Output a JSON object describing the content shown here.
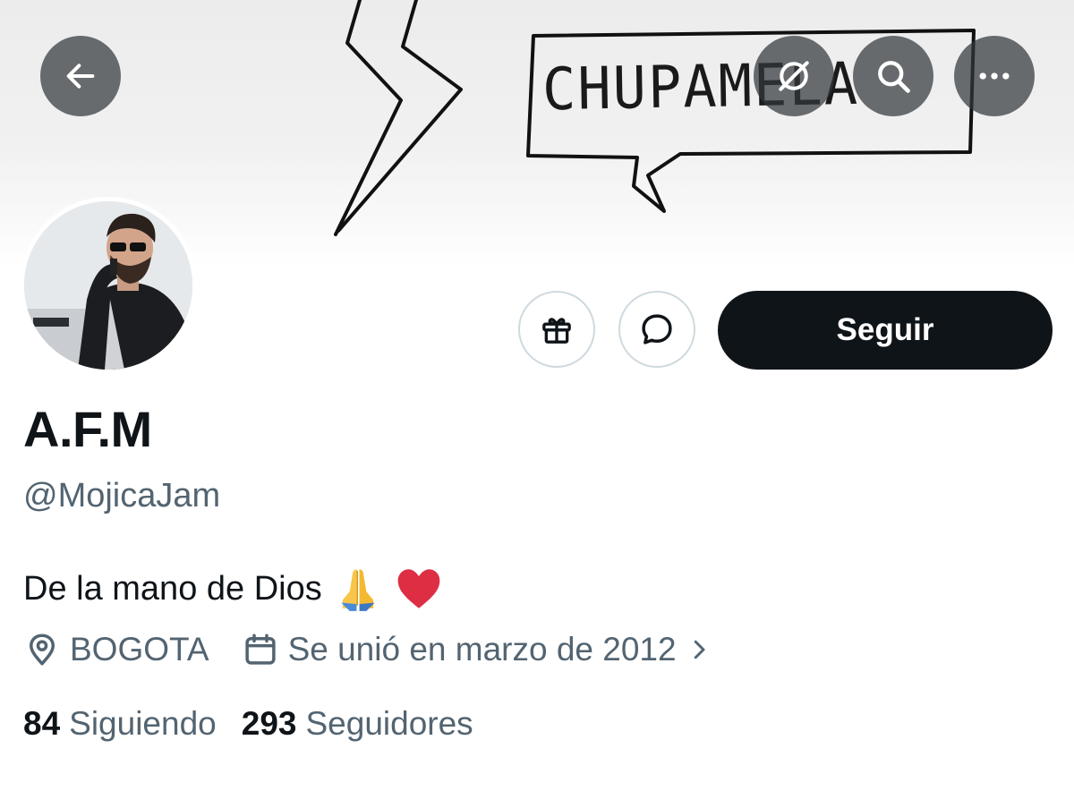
{
  "banner": {
    "drawing_text": "CHUPAMELA"
  },
  "nav": {
    "back_icon": "arrow-left-icon",
    "grok_icon": "grok-icon",
    "search_icon": "search-icon",
    "more_icon": "more-horizontal-icon"
  },
  "actions": {
    "gift_icon": "gift-icon",
    "message_icon": "message-bubble-icon",
    "follow_label": "Seguir"
  },
  "profile": {
    "name": "A.F.M",
    "handle": "@MojicaJam",
    "bio_text": "De la mano de Dios",
    "bio_emojis": [
      "🙏",
      "❤️"
    ],
    "location": "BOGOTA",
    "joined": "Se unió en marzo de 2012",
    "following_count": "84",
    "following_label": "Siguiendo",
    "followers_count": "293",
    "followers_label": "Seguidores"
  },
  "colors": {
    "text_primary": "#0f1419",
    "text_secondary": "#536471",
    "border": "#cfd9de",
    "follow_bg": "#0f1419",
    "overlay_btn": "#373c41"
  }
}
